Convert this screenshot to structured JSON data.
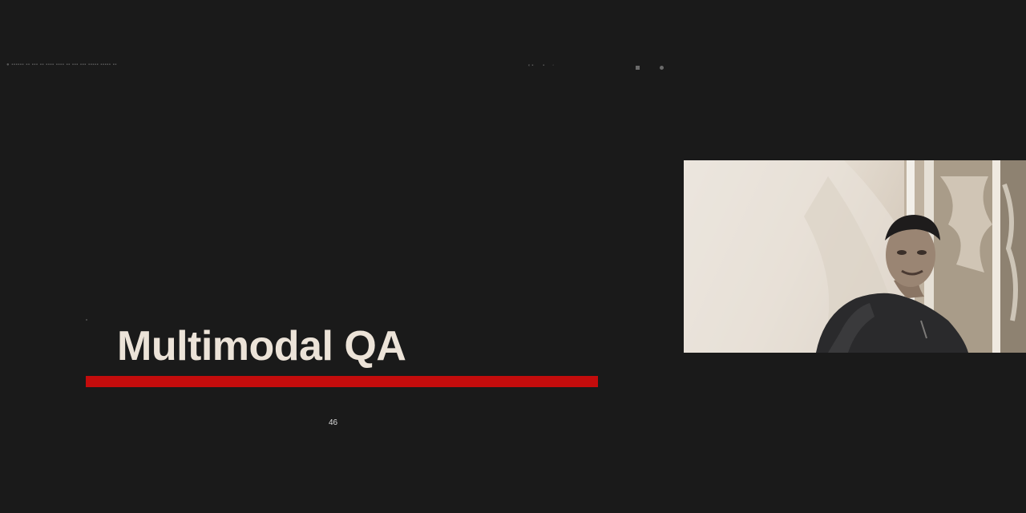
{
  "slide": {
    "title": "Multimodal QA",
    "page_number": "46",
    "rule_color": "#c40c0c",
    "background": "#1a1a1a"
  },
  "webcam": {
    "label": "presenter-video"
  }
}
